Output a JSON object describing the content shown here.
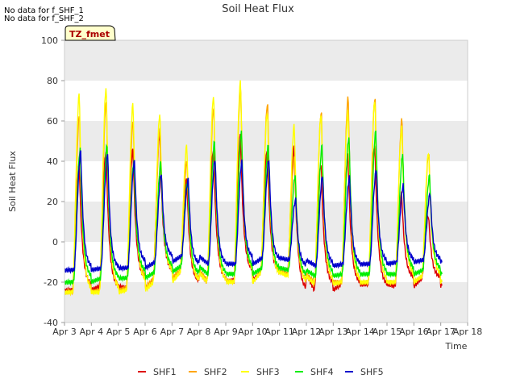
{
  "notes": [
    "No data for f_SHF_1",
    "No data for f_SHF_2"
  ],
  "badge": "TZ_fmet",
  "colors": {
    "SHF1": "#dd0000",
    "SHF2": "#ffa500",
    "SHF3": "#ffff00",
    "SHF4": "#00ee00",
    "SHF5": "#0000cc",
    "band": "#ebebeb",
    "badge_bg": "#ffffcc",
    "badge_text": "#aa0000"
  },
  "chart_data": {
    "type": "line",
    "title": "Soil Heat Flux",
    "xlabel": "Time",
    "ylabel": "Soil Heat Flux",
    "xlim": [
      3,
      18
    ],
    "ylim": [
      -40,
      100
    ],
    "yticks": [
      -40,
      -20,
      0,
      20,
      40,
      60,
      80,
      100
    ],
    "xticks": [
      {
        "x": 3,
        "label": "Apr 3"
      },
      {
        "x": 4,
        "label": "Apr 4"
      },
      {
        "x": 5,
        "label": "Apr 5"
      },
      {
        "x": 6,
        "label": "Apr 6"
      },
      {
        "x": 7,
        "label": "Apr 7"
      },
      {
        "x": 8,
        "label": "Apr 8"
      },
      {
        "x": 9,
        "label": "Apr 9"
      },
      {
        "x": 10,
        "label": "Apr 10"
      },
      {
        "x": 11,
        "label": "Apr 11"
      },
      {
        "x": 12,
        "label": "Apr 12"
      },
      {
        "x": 13,
        "label": "Apr 13"
      },
      {
        "x": 14,
        "label": "Apr 14"
      },
      {
        "x": 15,
        "label": "Apr 15"
      },
      {
        "x": 16,
        "label": "Apr 16"
      },
      {
        "x": 17,
        "label": "Apr 17"
      },
      {
        "x": 18,
        "label": "Apr 18"
      }
    ],
    "legend_position": "bottom",
    "series": [
      {
        "name": "SHF1",
        "day_peaks": [
          38,
          45,
          46,
          54,
          31,
          46,
          53,
          46,
          47,
          39,
          43,
          48,
          24,
          13
        ],
        "day_mins": [
          -24,
          -22,
          -23,
          -19,
          -15,
          -20,
          -19,
          -15,
          -16,
          -24,
          -21,
          -21,
          -22,
          -18
        ]
      },
      {
        "name": "SHF2",
        "day_peaks": [
          63,
          70,
          60,
          57,
          40,
          67,
          77,
          69,
          42,
          65,
          72,
          72,
          61,
          44
        ],
        "day_mins": [
          -25,
          -24,
          -23,
          -18,
          -14,
          -19,
          -20,
          -15,
          -16,
          -20,
          -20,
          -20,
          -20,
          -17
        ]
      },
      {
        "name": "SHF3",
        "day_peaks": [
          74,
          77,
          69,
          64,
          48,
          73,
          80,
          65,
          58,
          64,
          65,
          71,
          57,
          45
        ],
        "day_mins": [
          -25,
          -25,
          -24,
          -20,
          -15,
          -20,
          -20,
          -15,
          -17,
          -21,
          -20,
          -20,
          -20,
          -17
        ]
      },
      {
        "name": "SHF4",
        "day_peaks": [
          46,
          48,
          40,
          40,
          31,
          50,
          55,
          48,
          33,
          48,
          52,
          55,
          44,
          33
        ],
        "day_mins": [
          -20,
          -18,
          -18,
          -15,
          -12,
          -16,
          -16,
          -13,
          -14,
          -17,
          -16,
          -16,
          -16,
          -14
        ]
      },
      {
        "name": "SHF5",
        "day_peaks": [
          45,
          44,
          40,
          34,
          31,
          41,
          40,
          41,
          21,
          33,
          32,
          36,
          28,
          24
        ],
        "day_mins": [
          -14,
          -13,
          -13,
          -10,
          -7,
          -11,
          -11,
          -8,
          -9,
          -12,
          -11,
          -11,
          -10,
          -9
        ]
      }
    ]
  }
}
